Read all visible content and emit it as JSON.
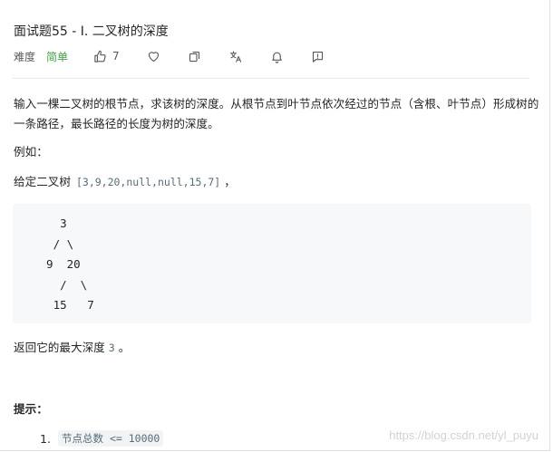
{
  "problem": {
    "title": "面试题55 - I. 二叉树的深度",
    "difficulty_label": "难度",
    "difficulty": "简单",
    "difficulty_color": "#43a047",
    "likes": "7"
  },
  "toolbar_icons": [
    "thumbs-up-icon",
    "heart-icon",
    "share-icon",
    "translate-icon",
    "bell-icon",
    "feedback-icon"
  ],
  "content": {
    "description": "输入一棵二叉树的根节点，求该树的深度。从根节点到叶节点依次经过的节点（含根、叶节点）形成树的一条路径，最长路径的长度为树的深度。",
    "example_label": "例如：",
    "given_prefix": "给定二叉树",
    "given_value": "[3,9,20,null,null,15,7]",
    "given_suffix": "，",
    "tree_text": "    3\n   / \\\n  9  20\n    /  \\\n   15   7",
    "result_prefix": "返回它的最大深度",
    "result_value": "3",
    "result_suffix": "。"
  },
  "hints": {
    "title": "提示：",
    "items": [
      {
        "number": "1.",
        "text": "节点总数 <= 10000"
      }
    ]
  },
  "watermark": "https://blog.csdn.net/yl_puyu"
}
